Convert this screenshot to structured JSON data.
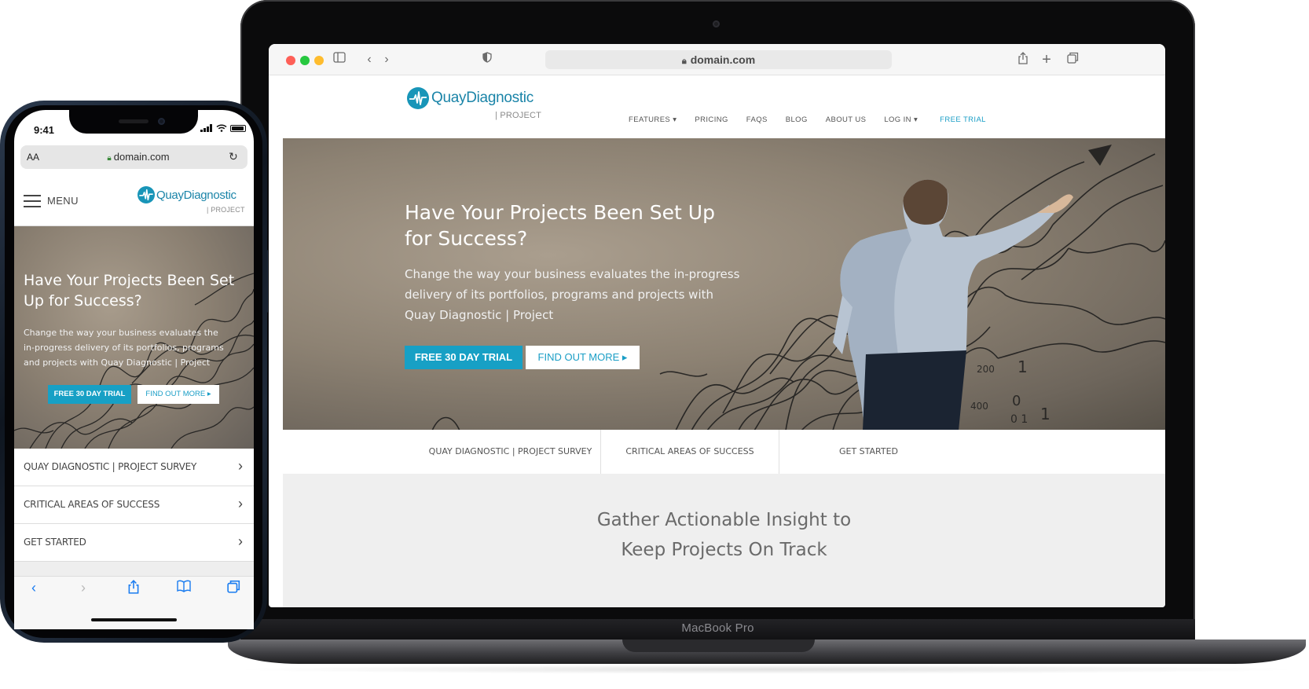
{
  "laptop": {
    "model_label": "MacBook Pro",
    "browser": {
      "url": "domain.com"
    },
    "site": {
      "logo": {
        "name": "QuayDiagnostic",
        "sub": "| PROJECT"
      },
      "nav": [
        "FEATURES ▾",
        "PRICING",
        "FAQS",
        "BLOG",
        "ABOUT US",
        "LOG IN ▾",
        "FREE TRIAL"
      ],
      "hero": {
        "title": "Have Your Projects Been Set Up for Success?",
        "text": "Change the way your business evaluates the in-progress delivery of its portfolios, programs and projects with Quay Diagnostic | Project",
        "primary_button": "FREE 30 DAY TRIAL",
        "secondary_button": "FIND OUT MORE ▸"
      },
      "tabs": [
        "QUAY DIAGNOSTIC | PROJECT SURVEY",
        "CRITICAL AREAS OF SUCCESS",
        "GET STARTED"
      ],
      "section_title_line1": "Gather Actionable Insight to",
      "section_title_line2": "Keep Projects On Track",
      "chalk": {
        "a": "200",
        "b": "1",
        "c": "400",
        "d": "0",
        "e": "0 1",
        "f": "1"
      }
    }
  },
  "phone": {
    "status": {
      "time": "9:41"
    },
    "browser": {
      "aa": "AA",
      "url": "domain.com"
    },
    "menu_label": "MENU",
    "logo": {
      "name": "QuayDiagnostic",
      "sub": "| PROJECT"
    },
    "hero": {
      "title": "Have Your Projects Been Set Up for Success?",
      "text": "Change the way your business evaluates the in-progress delivery of its portfolios, programs and projects with Quay Diagnostic | Project",
      "primary_button": "FREE 30 DAY TRIAL",
      "secondary_button": "FIND OUT MORE ▸"
    },
    "list": [
      "QUAY DIAGNOSTIC | PROJECT SURVEY",
      "CRITICAL AREAS OF SUCCESS",
      "GET STARTED"
    ]
  },
  "colors": {
    "brand": "#1a84a8",
    "accent": "#17a0c5",
    "ios_blue": "#1a7cf0"
  }
}
